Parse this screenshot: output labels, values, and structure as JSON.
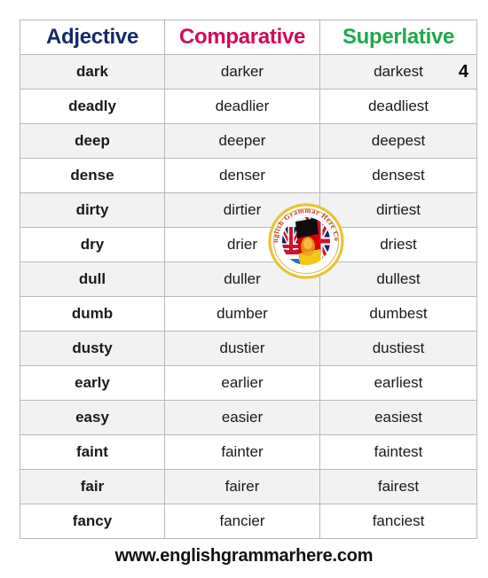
{
  "table": {
    "headers": {
      "adjective": "Adjective",
      "comparative": "Comparative",
      "superlative": "Superlative"
    },
    "header_colors": {
      "adjective": "#152a6e",
      "comparative": "#d10a57",
      "superlative": "#1fa84c"
    },
    "corner_number": "4",
    "rows": [
      {
        "adjective": "dark",
        "comparative": "darker",
        "superlative": "darkest"
      },
      {
        "adjective": "deadly",
        "comparative": "deadlier",
        "superlative": "deadliest"
      },
      {
        "adjective": "deep",
        "comparative": "deeper",
        "superlative": "deepest"
      },
      {
        "adjective": "dense",
        "comparative": "denser",
        "superlative": "densest"
      },
      {
        "adjective": "dirty",
        "comparative": "dirtier",
        "superlative": "dirtiest"
      },
      {
        "adjective": "dry",
        "comparative": "drier",
        "superlative": "driest"
      },
      {
        "adjective": "dull",
        "comparative": "duller",
        "superlative": "dullest"
      },
      {
        "adjective": "dumb",
        "comparative": "dumber",
        "superlative": "dumbest"
      },
      {
        "adjective": "dusty",
        "comparative": "dustier",
        "superlative": "dustiest"
      },
      {
        "adjective": "early",
        "comparative": "earlier",
        "superlative": "earliest"
      },
      {
        "adjective": "easy",
        "comparative": "easier",
        "superlative": "easiest"
      },
      {
        "adjective": "faint",
        "comparative": "fainter",
        "superlative": "faintest"
      },
      {
        "adjective": "fair",
        "comparative": "fairer",
        "superlative": "fairest"
      },
      {
        "adjective": "fancy",
        "comparative": "fancier",
        "superlative": "fanciest"
      }
    ]
  },
  "logo": {
    "name": "english-grammar-here-logo",
    "arc_text": "English Grammar Here Com",
    "ring_color": "#e8c33a",
    "text_color": "#c0392b"
  },
  "footer": {
    "url": "www.englishgrammarhere.com"
  }
}
